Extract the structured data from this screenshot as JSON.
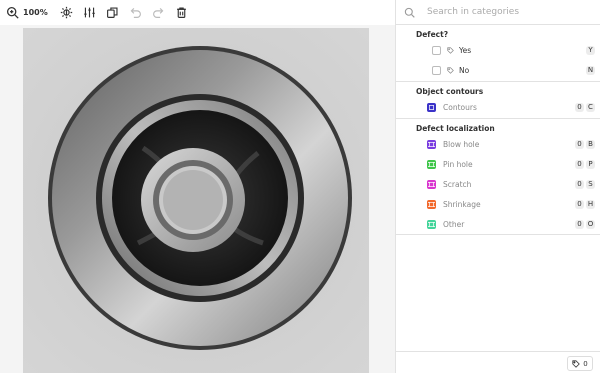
{
  "toolbar": {
    "zoom_value": "100%",
    "icons": [
      "zoom-in-icon",
      "brightness-icon",
      "sliders-icon",
      "copy-icon",
      "undo-icon",
      "redo-icon",
      "trash-icon"
    ]
  },
  "search": {
    "placeholder": "Search in categories",
    "value": ""
  },
  "groups": {
    "defect": {
      "title": "Defect?",
      "options": [
        {
          "label": "Yes",
          "key": "Y"
        },
        {
          "label": "No",
          "key": "N"
        }
      ]
    },
    "contours": {
      "title": "Object contours",
      "classes": [
        {
          "label": "Contours",
          "count": "0",
          "key": "C",
          "color": "#3b32c8"
        }
      ]
    },
    "localization": {
      "title": "Defect localization",
      "classes": [
        {
          "label": "Blow hole",
          "count": "0",
          "key": "B",
          "color": "#7a3ce0"
        },
        {
          "label": "Pin hole",
          "count": "0",
          "key": "P",
          "color": "#3fc64a"
        },
        {
          "label": "Scratch",
          "count": "0",
          "key": "S",
          "color": "#d936cf"
        },
        {
          "label": "Shrinkage",
          "count": "0",
          "key": "H",
          "color": "#f2692c"
        },
        {
          "label": "Other",
          "count": "0",
          "key": "O",
          "color": "#43d49a"
        }
      ]
    }
  },
  "footer": {
    "tag_count": "0"
  }
}
